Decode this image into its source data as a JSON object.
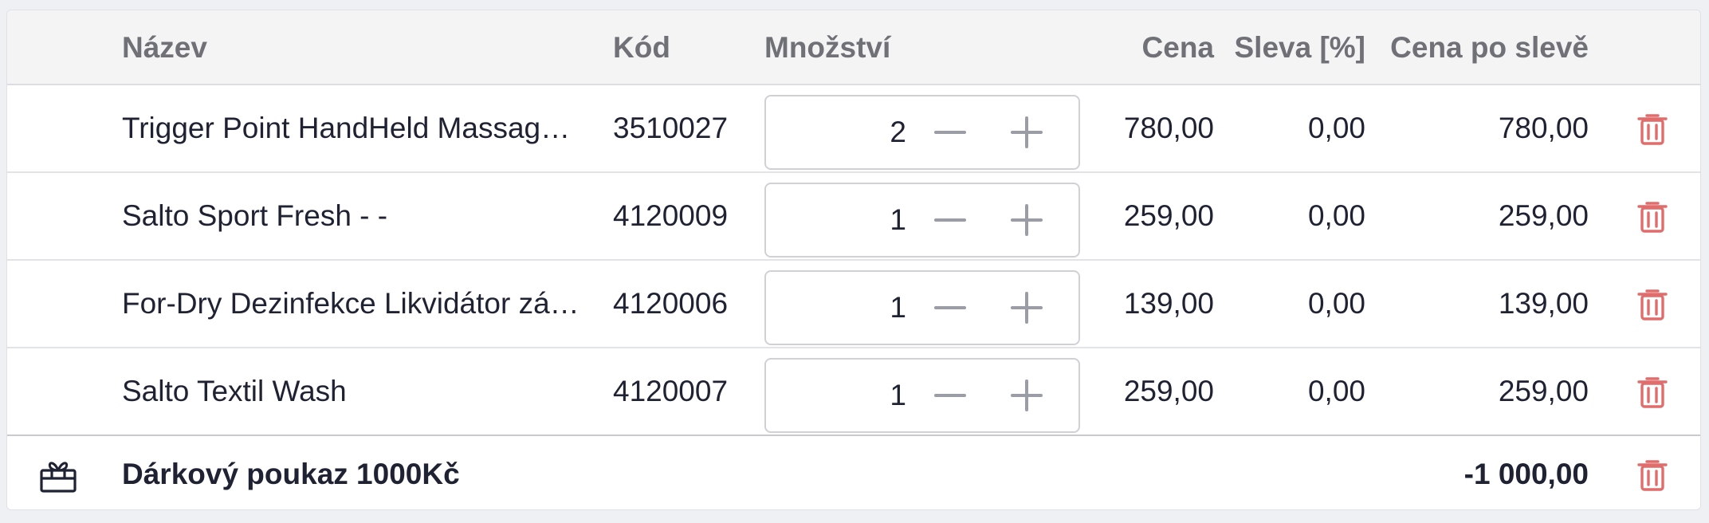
{
  "columns": {
    "name": "Název",
    "code": "Kód",
    "quantity": "Množství",
    "price": "Cena",
    "discount": "Sleva [%]",
    "final_price": "Cena po slevě"
  },
  "items": [
    {
      "name": "Trigger Point HandHeld Massag…",
      "code": "3510027",
      "quantity": "2",
      "price": "780,00",
      "discount": "0,00",
      "final_price": "780,00"
    },
    {
      "name": "Salto Sport Fresh - -",
      "code": "4120009",
      "quantity": "1",
      "price": "259,00",
      "discount": "0,00",
      "final_price": "259,00"
    },
    {
      "name": "For-Dry Dezinfekce Likvidátor zá…",
      "code": "4120006",
      "quantity": "1",
      "price": "139,00",
      "discount": "0,00",
      "final_price": "139,00"
    },
    {
      "name": "Salto Textil Wash",
      "code": "4120007",
      "quantity": "1",
      "price": "259,00",
      "discount": "0,00",
      "final_price": "259,00"
    }
  ],
  "voucher": {
    "name": "Dárkový poukaz 1000Kč",
    "amount": "-1 000,00"
  },
  "icons": {
    "delete": "trash-icon",
    "decrement": "minus-icon",
    "increment": "plus-icon",
    "voucher": "gift-icon"
  },
  "colors": {
    "delete_icon": "#e06c6c",
    "stepper_icon": "#9a9ca6",
    "header_text": "#6f7177",
    "text": "#1f2233"
  }
}
